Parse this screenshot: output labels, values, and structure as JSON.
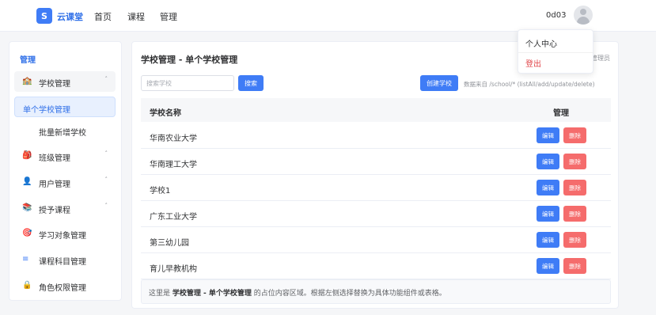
{
  "topbar": {
    "logo_letter": "S",
    "brand": "云课堂",
    "nav": [
      "首页",
      "课程",
      "管理"
    ],
    "user_name": "0d03"
  },
  "user_menu": {
    "items": [
      "个人中心",
      "登出"
    ]
  },
  "sidebar": {
    "title": "管理",
    "items": [
      {
        "label": "学校管理",
        "icon": "school-icon",
        "glyph": "🏫",
        "type": "group",
        "expanded": true
      },
      {
        "label": "单个学校管理",
        "type": "sub",
        "active": true
      },
      {
        "label": "批量新增学校",
        "type": "sub"
      },
      {
        "label": "班级管理",
        "icon": "bag-icon",
        "glyph": "🎒",
        "type": "group"
      },
      {
        "label": "用户管理",
        "icon": "user-icon",
        "glyph": "👤",
        "type": "group"
      },
      {
        "label": "授予课程",
        "icon": "books-icon",
        "glyph": "📚",
        "type": "group"
      },
      {
        "label": "学习对象管理",
        "icon": "target-icon",
        "glyph": "🎯",
        "type": "item"
      },
      {
        "label": "课程科目管理",
        "icon": "list-icon",
        "glyph": "≡",
        "type": "item"
      },
      {
        "label": "角色权限管理",
        "icon": "lock-icon",
        "glyph": "🔒",
        "type": "item"
      }
    ]
  },
  "main": {
    "title": "学校管理 - 单个学校管理",
    "admin_hint": "管理员",
    "search_placeholder": "搜索学校",
    "search_button": "搜索",
    "create_button": "创建学校",
    "source_note": "数据来自 /school/* (listAll/add/update/delete)",
    "table": {
      "col_name": "学校名称",
      "col_actions": "管理",
      "edit_label": "编辑",
      "delete_label": "删除",
      "rows": [
        "华南农业大学",
        "华南理工大学",
        "学校1",
        "广东工业大学",
        "第三幼儿园",
        "育儿早教机构"
      ]
    },
    "footer": {
      "prefix": "这里是 ",
      "highlight": "学校管理 - 单个学校管理",
      "suffix": " 的占位内容区域。根据左侧选择替换为具体功能组件或表格。"
    }
  },
  "colors": {
    "primary": "#3f7cf6",
    "danger": "#f56c6c",
    "logout": "#e0454a"
  }
}
